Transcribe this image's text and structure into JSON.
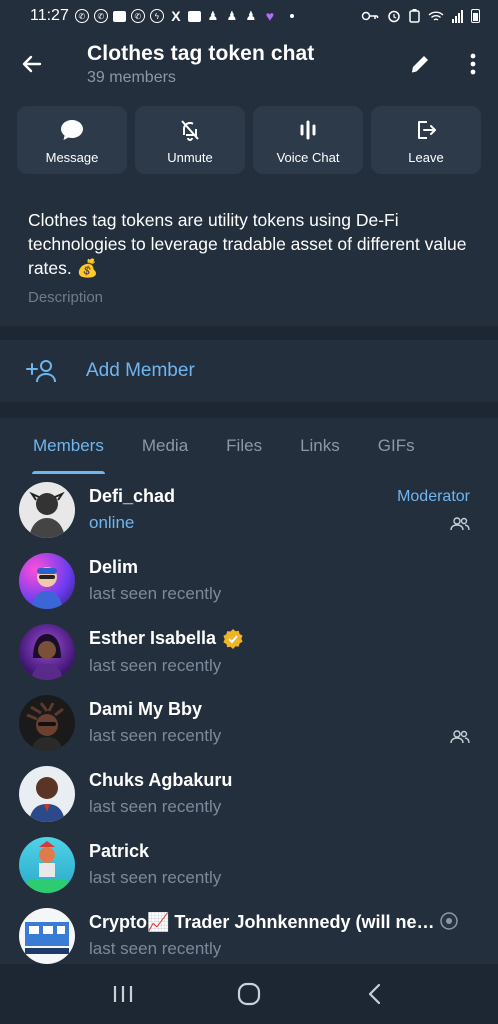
{
  "status_bar": {
    "time": "11:27",
    "icons": [
      "whatsapp-icon",
      "whatsapp-icon",
      "chat-icon",
      "whatsapp-icon",
      "messenger-icon",
      "x-icon",
      "gallery-icon",
      "snapchat-icon",
      "snapchat-icon",
      "snapchat-icon",
      "heart-icon"
    ],
    "right_icons": [
      "key-icon",
      "alarm-icon",
      "battery-saver-icon",
      "wifi-icon",
      "signal-icon",
      "battery-icon"
    ]
  },
  "header": {
    "title": "Clothes tag token chat",
    "subtitle": "39 members"
  },
  "actions": [
    {
      "label": "Message",
      "icon": "message-bubble-icon"
    },
    {
      "label": "Unmute",
      "icon": "bell-off-icon"
    },
    {
      "label": "Voice Chat",
      "icon": "voice-chat-icon"
    },
    {
      "label": "Leave",
      "icon": "leave-icon"
    }
  ],
  "description": {
    "text": "Clothes tag tokens are utility tokens using De-Fi technologies to leverage tradable asset of different value rates. 💰",
    "label": "Description"
  },
  "add_member": {
    "label": "Add Member"
  },
  "tabs": [
    {
      "label": "Members",
      "active": true
    },
    {
      "label": "Media",
      "active": false
    },
    {
      "label": "Files",
      "active": false
    },
    {
      "label": "Links",
      "active": false
    },
    {
      "label": "GIFs",
      "active": false
    }
  ],
  "members": [
    {
      "name": "Defi_chad",
      "status": "online",
      "role": "Moderator",
      "group_icon": true
    },
    {
      "name": "Delim",
      "status": "last seen recently"
    },
    {
      "name": "Esther Isabella",
      "status": "last seen recently",
      "verified": true
    },
    {
      "name": "Dami My Bby",
      "status": "last seen recently",
      "group_icon": true
    },
    {
      "name": "Chuks Agbakuru",
      "status": "last seen recently"
    },
    {
      "name": "Patrick",
      "status": "last seen recently"
    },
    {
      "name": "Crypto📈 Trader Johnkennedy (will ne…",
      "status": "last seen recently"
    }
  ],
  "colors": {
    "background": "#242f3d",
    "accent": "#6fb6ef",
    "button": "#2d3a4a",
    "secondary_text": "#8a98a8"
  }
}
